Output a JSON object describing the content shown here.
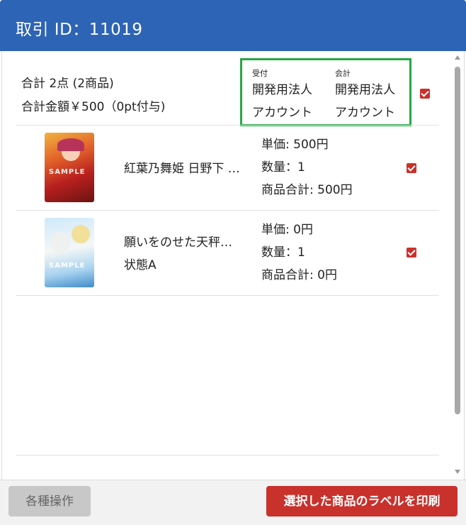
{
  "header": {
    "title": "取引 ID：11019"
  },
  "summary": {
    "count": "合計 2点 (2商品)",
    "amount": "合計金額￥500（0pt付与)"
  },
  "staff": {
    "reception": {
      "label": "受付",
      "line1": "開発用法人",
      "line2": "アカウント"
    },
    "cashier": {
      "label": "会計",
      "line1": "開発用法人",
      "line2": "アカウント"
    }
  },
  "items": [
    {
      "name": "紅葉乃舞姫 日野下 …",
      "condition": "",
      "unit_price": "単価: 500円",
      "quantity": "数量：1",
      "subtotal": "商品合計: 500円",
      "checked": true,
      "card_sample": "SAMPLE"
    },
    {
      "name": "願いをのせた天秤…",
      "condition": "状態A",
      "unit_price": "単価: 0円",
      "quantity": "数量：1",
      "subtotal": "商品合計: 0円",
      "checked": true,
      "card_sample": "SAMPLE"
    }
  ],
  "footer": {
    "operations_label": "各種操作",
    "print_label": "選択した商品のラベルを印刷"
  },
  "colors": {
    "header": "#2e64b5",
    "accent_red": "#c9312c",
    "highlight_green": "#27a745"
  }
}
